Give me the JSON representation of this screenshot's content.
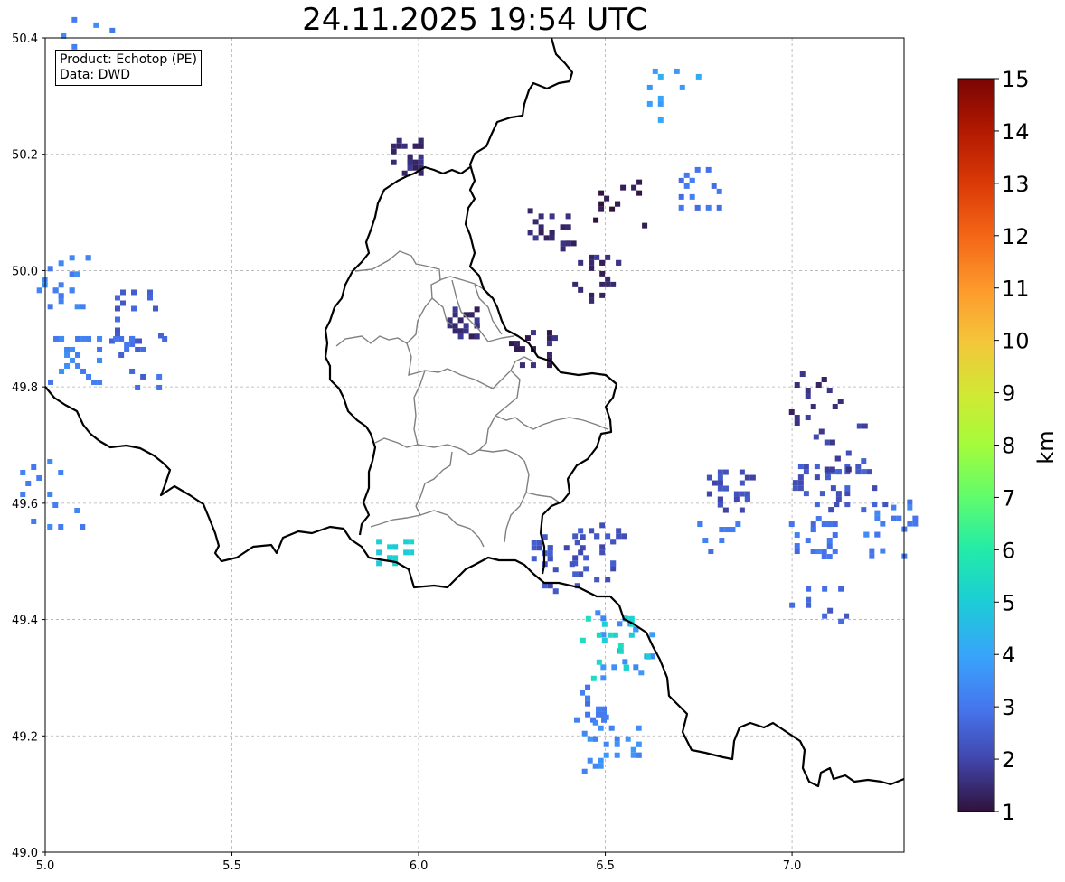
{
  "title": "24.11.2025 19:54 UTC",
  "info": {
    "product": "Product: Echotop (PE)",
    "data": "Data: DWD"
  },
  "map": {
    "lon_range": [
      5.0,
      7.3
    ],
    "lat_range": [
      49.0,
      50.4
    ],
    "x_ticks": [
      "5.0",
      "5.5",
      "6.0",
      "6.5",
      "7.0"
    ],
    "y_ticks": [
      "49.0",
      "49.2",
      "49.4",
      "49.6",
      "49.8",
      "50.0",
      "50.2",
      "50.4"
    ],
    "grid": true
  },
  "colorbar": {
    "label": "km",
    "ticks": [
      "1",
      "2",
      "3",
      "4",
      "5",
      "6",
      "7",
      "8",
      "9",
      "10",
      "11",
      "12",
      "13",
      "14",
      "15"
    ],
    "range": [
      1,
      15
    ],
    "colormap": "turbo"
  },
  "chart_data": {
    "type": "heatmap",
    "title": "24.11.2025 19:54 UTC",
    "xlim": [
      5.0,
      7.3
    ],
    "ylim": [
      49.0,
      50.4
    ],
    "value_label": "km",
    "value_range": [
      1,
      15
    ],
    "echo_cells": [
      {
        "lon": 5.08,
        "lat": 49.85,
        "km": 3.3
      },
      {
        "lon": 5.05,
        "lat": 49.98,
        "km": 3.3
      },
      {
        "lon": 5.23,
        "lat": 49.93,
        "km": 2.6
      },
      {
        "lon": 5.24,
        "lat": 49.85,
        "km": 2.8
      },
      {
        "lon": 5.02,
        "lat": 49.62,
        "km": 3.3
      },
      {
        "lon": 5.1,
        "lat": 50.38,
        "km": 3.3
      },
      {
        "lon": 5.97,
        "lat": 50.2,
        "km": 1.5
      },
      {
        "lon": 6.12,
        "lat": 49.91,
        "km": 1.5
      },
      {
        "lon": 6.35,
        "lat": 50.07,
        "km": 1.5
      },
      {
        "lon": 6.47,
        "lat": 49.99,
        "km": 1.5
      },
      {
        "lon": 6.3,
        "lat": 49.87,
        "km": 1.4
      },
      {
        "lon": 6.74,
        "lat": 50.15,
        "km": 3.0
      },
      {
        "lon": 6.54,
        "lat": 50.11,
        "km": 1.2
      },
      {
        "lon": 6.67,
        "lat": 50.31,
        "km": 4.0
      },
      {
        "lon": 6.47,
        "lat": 49.52,
        "km": 2.3
      },
      {
        "lon": 6.36,
        "lat": 49.5,
        "km": 2.3
      },
      {
        "lon": 6.56,
        "lat": 49.36,
        "km": 3.6
      },
      {
        "lon": 6.52,
        "lat": 49.35,
        "km": 5.2
      },
      {
        "lon": 6.46,
        "lat": 49.26,
        "km": 3.0
      },
      {
        "lon": 5.93,
        "lat": 49.52,
        "km": 5.1
      },
      {
        "lon": 6.79,
        "lat": 49.55,
        "km": 3.1
      },
      {
        "lon": 6.83,
        "lat": 49.63,
        "km": 2.2
      },
      {
        "lon": 7.05,
        "lat": 49.55,
        "km": 3.0
      },
      {
        "lon": 7.06,
        "lat": 49.64,
        "km": 2.4
      },
      {
        "lon": 7.25,
        "lat": 49.56,
        "km": 3.2
      },
      {
        "lon": 7.17,
        "lat": 49.64,
        "km": 2.4
      },
      {
        "lon": 7.05,
        "lat": 49.78,
        "km": 1.6
      },
      {
        "lon": 7.13,
        "lat": 49.7,
        "km": 1.9
      },
      {
        "lon": 7.08,
        "lat": 49.42,
        "km": 2.6
      },
      {
        "lon": 6.51,
        "lat": 49.19,
        "km": 3.5
      }
    ]
  }
}
